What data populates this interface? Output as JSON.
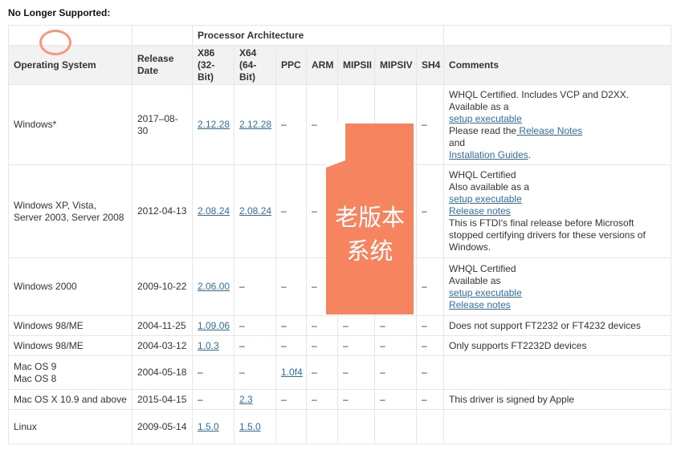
{
  "heading": "No Longer Supported:",
  "table": {
    "processor_header": "Processor Architecture",
    "columns": [
      "Operating System",
      "Release Date",
      "X86 (32-Bit)",
      "X64 (64-Bit)",
      "PPC",
      "ARM",
      "MIPSII",
      "MIPSIV",
      "SH4",
      "Comments"
    ],
    "rows": [
      {
        "os": "Windows*",
        "date": "2017–08-30",
        "x86": "2.12.28",
        "x64": "2.12.28",
        "ppc": "–",
        "arm": "–",
        "mipsii": "–",
        "mipsiv": "–",
        "sh4": "–",
        "comments": [
          {
            "text": "WHQL Certified. Includes VCP and D2XX."
          },
          {
            "text": "Available as a"
          },
          {
            "text": "setup executable",
            "link": true
          },
          {
            "text": "Please read the",
            "inline": true
          },
          {
            "text": " Release Notes",
            "link": true,
            "inline": true
          },
          {
            "text": "and"
          },
          {
            "text": "Installation Guides",
            "link": true,
            "inline": true
          },
          {
            "text": ".",
            "inline": true
          }
        ]
      },
      {
        "os": "Windows XP, Vista, Server 2003, Server 2008",
        "date": "2012-04-13",
        "x86": "2.08.24",
        "x64": "2.08.24",
        "ppc": "–",
        "arm": "–",
        "mipsii": "–",
        "mipsiv": "–",
        "sh4": "–",
        "comments": [
          {
            "text": "WHQL Certified"
          },
          {
            "text": "Also available as a"
          },
          {
            "text": "setup executable",
            "link": true
          },
          {
            "text": "Release notes",
            "link": true
          },
          {
            "text": "This is FTDI's final release before Microsoft stopped certifying drivers for these versions of Windows."
          }
        ]
      },
      {
        "os": "Windows 2000",
        "date": "2009-10-22",
        "x86": "2.06.00",
        "x64": "–",
        "ppc": "–",
        "arm": "–",
        "mipsii": "–",
        "mipsiv": "–",
        "sh4": "–",
        "comments": [
          {
            "text": "WHQL Certified"
          },
          {
            "text": "Available as"
          },
          {
            "text": "setup executable",
            "link": true
          },
          {
            "text": "Release notes",
            "link": true
          }
        ]
      },
      {
        "os": "Windows 98/ME",
        "date": "2004-11-25",
        "x86": "1.09.06",
        "x64": "–",
        "ppc": "–",
        "arm": "–",
        "mipsii": "–",
        "mipsiv": "–",
        "sh4": "–",
        "comments": [
          {
            "text": "Does not support FT2232 or FT4232 devices"
          }
        ]
      },
      {
        "os": "Windows 98/ME",
        "date": "2004-03-12",
        "x86": "1.0.3",
        "x64": "–",
        "ppc": "–",
        "arm": "–",
        "mipsii": "–",
        "mipsiv": "–",
        "sh4": "–",
        "comments": [
          {
            "text": "Only supports FT2232D devices"
          }
        ]
      },
      {
        "os": "Mac OS 9\nMac OS 8",
        "date": "2004-05-18",
        "x86": "–",
        "x64": "–",
        "ppc": "1.0f4",
        "arm": "–",
        "mipsii": "–",
        "mipsiv": "–",
        "sh4": "–",
        "comments": []
      },
      {
        "os": "Mac OS X 10.9 and above",
        "date": "2015-04-15",
        "x86": "–",
        "x64": "2.3",
        "ppc": "–",
        "arm": "–",
        "mipsii": "–",
        "mipsiv": "–",
        "sh4": "–",
        "comments": [
          {
            "text": "This driver is signed by Apple"
          }
        ]
      },
      {
        "os": "Linux",
        "date": "2009-05-14",
        "x86": "1.5.0",
        "x64": "1.5.0",
        "ppc": "",
        "arm": "",
        "mipsii": "",
        "mipsiv": "",
        "sh4": "",
        "comments": []
      }
    ]
  },
  "overlay": {
    "line1": "老版本",
    "line2": "系统",
    "color": "#f5845f"
  },
  "colors": {
    "link": "#2e6fa8",
    "header_bg": "#f2f2f2",
    "border": "#e6e6e6",
    "circle": "#f49a7a"
  }
}
